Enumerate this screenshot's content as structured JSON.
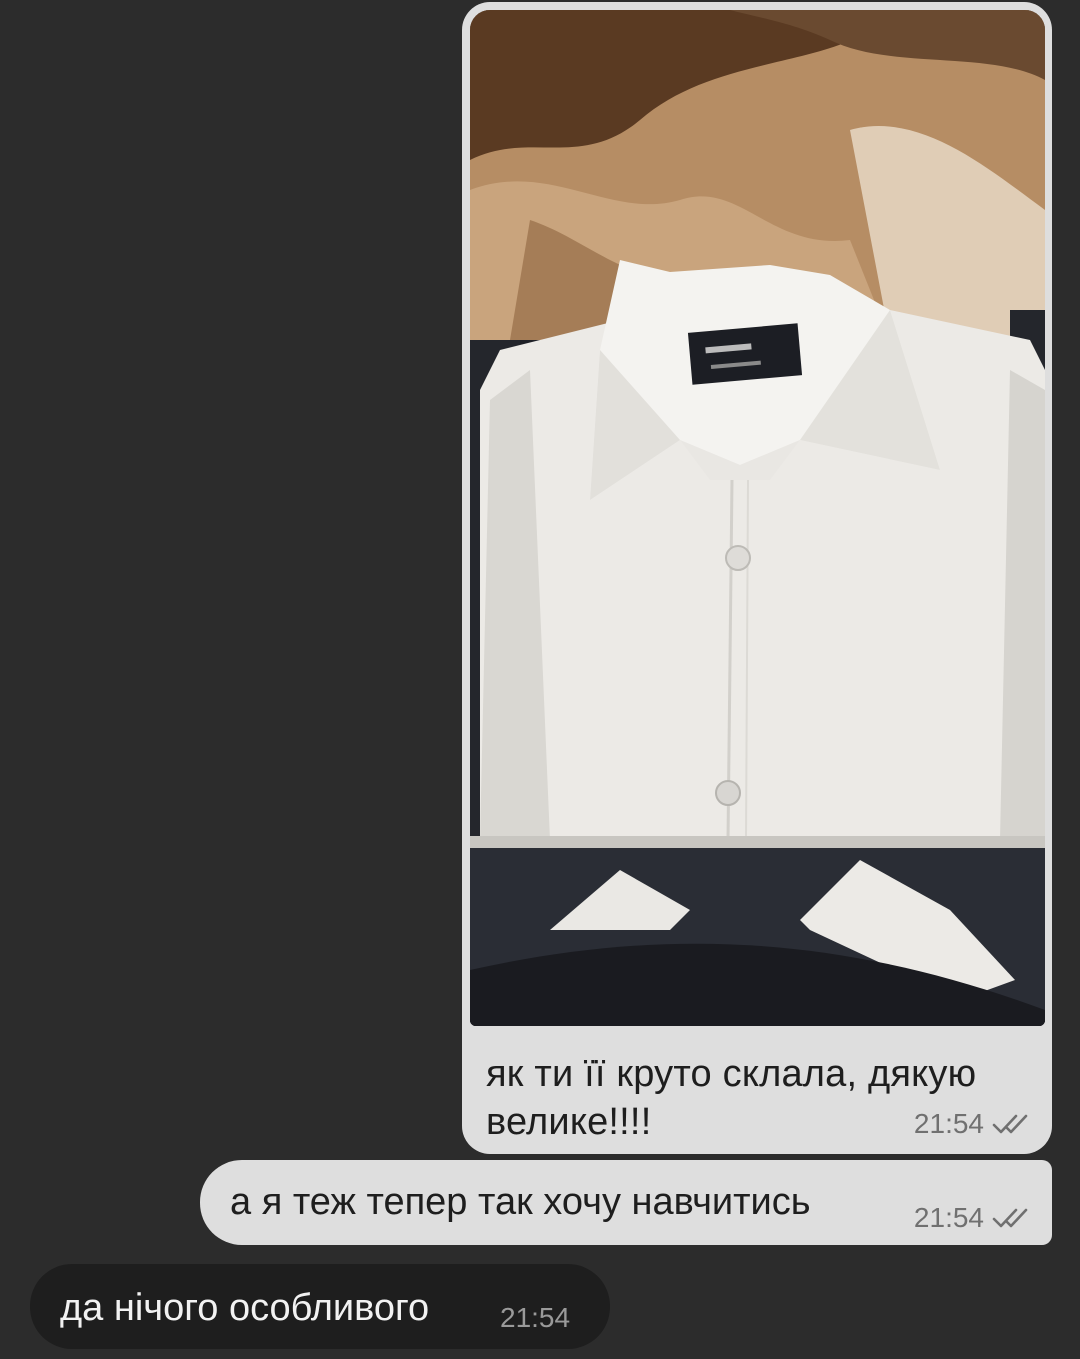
{
  "messages": [
    {
      "direction": "outgoing",
      "type": "photo",
      "photo_icon": "photo-shirt-image",
      "caption": "як ти її круто склала, дякую велике!!!!",
      "time": "21:54",
      "status_icon": "double-check-icon"
    },
    {
      "direction": "outgoing",
      "type": "text",
      "text": "а я теж тепер так хочу навчитись",
      "time": "21:54",
      "status_icon": "double-check-icon"
    },
    {
      "direction": "incoming",
      "type": "text",
      "text": "да нічого особливого",
      "time": "21:54"
    }
  ],
  "colors": {
    "background": "#2c2c2c",
    "outgoing_bubble": "#dedede",
    "incoming_bubble": "#1e1e1e",
    "meta_text": "#707070"
  }
}
